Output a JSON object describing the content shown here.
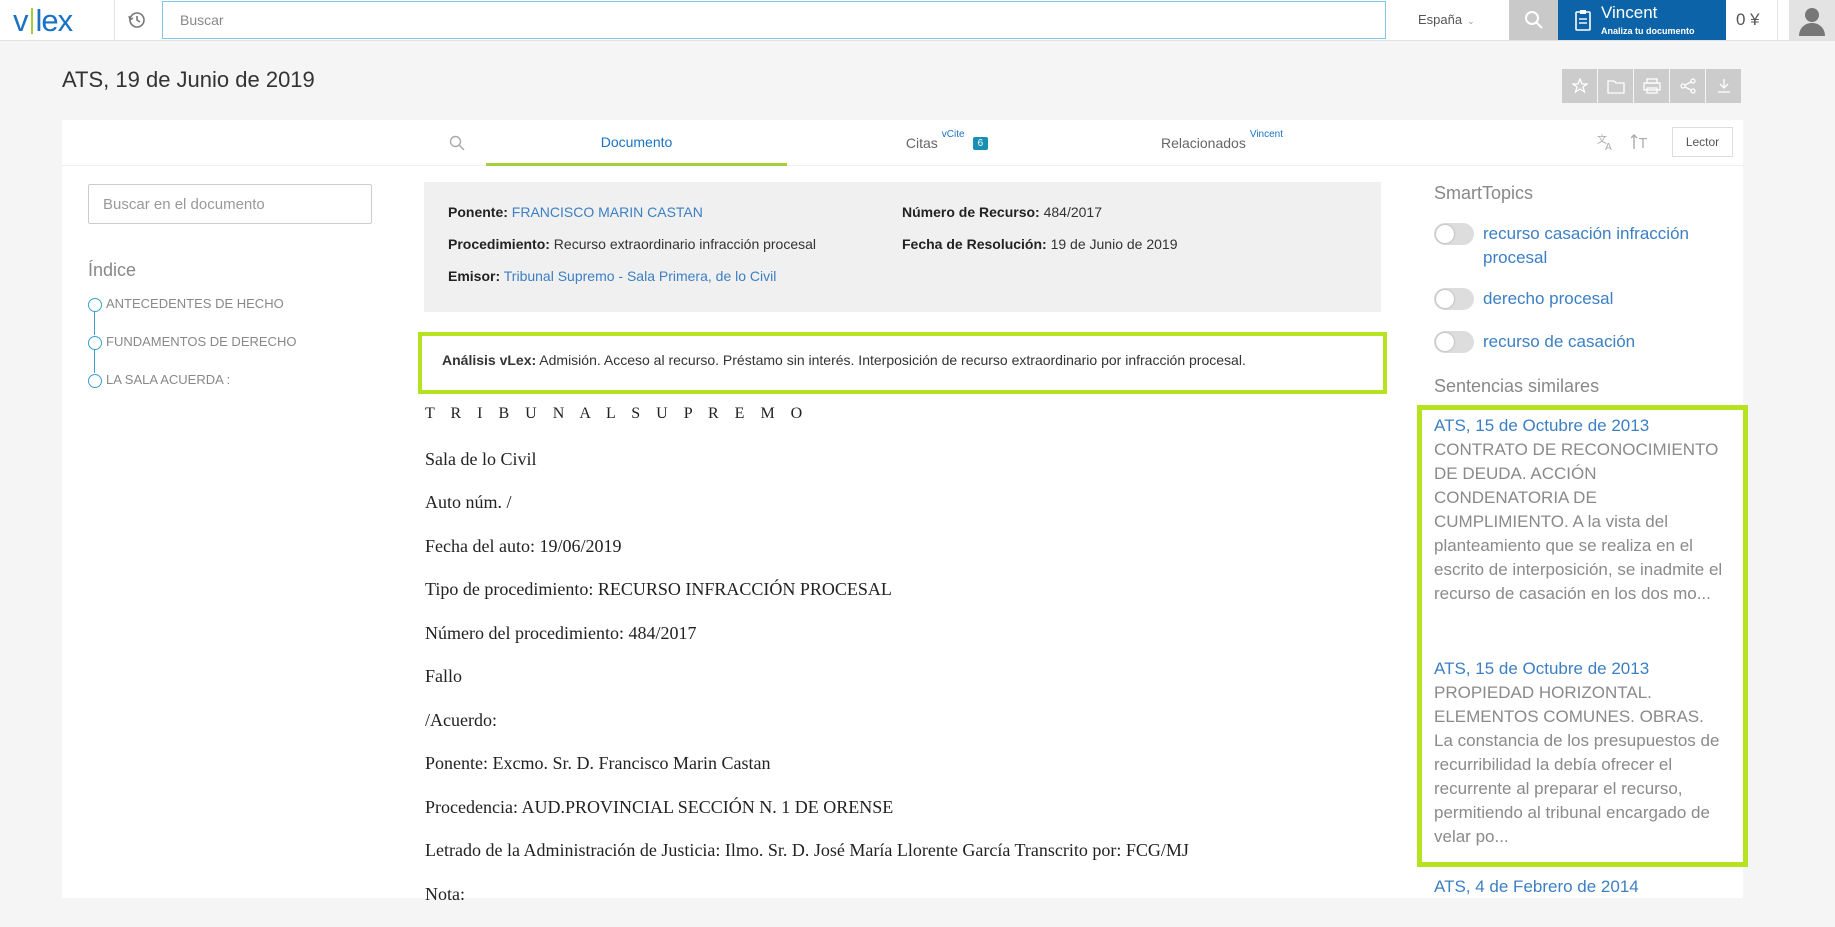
{
  "header": {
    "logo": "vlex",
    "search_placeholder": "Buscar",
    "country": "España",
    "vincent_title": "Vincent",
    "vincent_subtitle": "Analiza tu documento",
    "credits": "0 ¥"
  },
  "page": {
    "title": "ATS, 19 de Junio de 2019"
  },
  "tabs": [
    {
      "label": "Documento",
      "active": true
    },
    {
      "label": "Citas",
      "sup": "vCite",
      "badge": "6"
    },
    {
      "label": "Relacionados",
      "sup": "Vincent"
    }
  ],
  "toolbar": {
    "lector": "Lector"
  },
  "sidebar": {
    "search_placeholder": "Buscar en el documento",
    "index_title": "Índice",
    "items": [
      "ANTECEDENTES DE HECHO",
      "FUNDAMENTOS DE DERECHO",
      "LA SALA ACUERDA :"
    ]
  },
  "meta": {
    "ponente_label": "Ponente:",
    "ponente_value": "FRANCISCO MARIN CASTAN",
    "procedimiento_label": "Procedimiento:",
    "procedimiento_value": "Recurso extraordinario infracción procesal",
    "emisor_label": "Emisor:",
    "emisor_value": "Tribunal Supremo - Sala Primera, de lo Civil",
    "numero_label": "Número de Recurso:",
    "numero_value": "484/2017",
    "fecha_label": "Fecha de Resolución:",
    "fecha_value": "19 de Junio de 2019"
  },
  "analysis": {
    "label": "Análisis vLex:",
    "text": "Admisión. Acceso al recurso. Préstamo sin interés. Interposición de recurso extraordinario por infracción procesal."
  },
  "document_lines": [
    "T R I B U N A L S U P R E M O",
    "Sala de lo Civil",
    "Auto núm. /",
    "Fecha del auto: 19/06/2019",
    "Tipo de procedimiento: RECURSO INFRACCIÓN PROCESAL",
    "Número del procedimiento: 484/2017",
    "Fallo",
    "/Acuerdo:",
    "Ponente: Excmo. Sr. D. Francisco Marin Castan",
    "Procedencia: AUD.PROVINCIAL SECCIÓN N. 1 DE ORENSE",
    "Letrado de la Administración de Justicia: Ilmo. Sr. D. José María Llorente García Transcrito por: FCG/MJ",
    "Nota:"
  ],
  "smarttopics": {
    "title": "SmartTopics",
    "items": [
      "recurso casación infracción procesal",
      "derecho procesal",
      "recurso de casación"
    ]
  },
  "similares": {
    "title": "Sentencias similares",
    "items": [
      {
        "title": "ATS, 15 de Octubre de 2013",
        "desc": "CONTRATO DE RECONOCIMIENTO DE DEUDA. ACCIÓN CONDENATORIA DE CUMPLIMIENTO. A la vista del planteamiento que se realiza en el escrito de interposición, se inadmite el recurso de casación en los dos mo..."
      },
      {
        "title": "ATS, 15 de Octubre de 2013",
        "desc": "PROPIEDAD HORIZONTAL. ELEMENTOS COMUNES. OBRAS. La constancia de los presupuestos de recurribilidad la debía ofrecer el recurrente al preparar el recurso, permitiendo al tribunal encargado de velar po..."
      },
      {
        "title": "ATS, 4 de Febrero de 2014",
        "desc": ""
      }
    ]
  },
  "colors": {
    "brand": "#1a72c4",
    "accent": "#a6ce39",
    "highlight": "#b5e31f",
    "vincent": "#0c63a8"
  }
}
